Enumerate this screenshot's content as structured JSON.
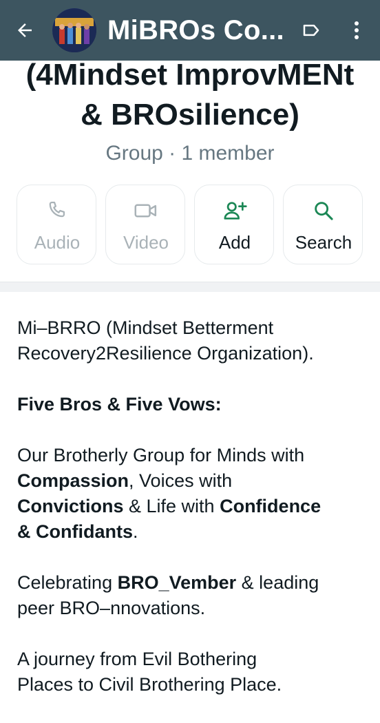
{
  "header": {
    "title": "MiBROs Co...",
    "back_icon": "arrow-left-icon",
    "label_icon": "label-icon",
    "menu_icon": "more-vertical-icon"
  },
  "group": {
    "name_line1": "(4Mindset ImprovMENt",
    "name_line2": "& BROsilience)",
    "subtitle": "Group · 1 member"
  },
  "actions": [
    {
      "label": "Audio",
      "icon": "phone-icon",
      "enabled": false
    },
    {
      "label": "Video",
      "icon": "video-camera-icon",
      "enabled": false
    },
    {
      "label": "Add",
      "icon": "add-person-icon",
      "enabled": true
    },
    {
      "label": "Search",
      "icon": "search-icon",
      "enabled": true
    }
  ],
  "description": {
    "p1_line1": "Mi–BRRO (Mindset Betterment",
    "p1_line2": "Recovery2Resilience Organization).",
    "p2": "Five Bros & Five Vows:",
    "p3_a": "Our Brotherly Group for Minds with",
    "p3_b_bold": "Compassion",
    "p3_c": ", Voices with",
    "p3_d_bold": "Convictions",
    "p3_e": " & Life with ",
    "p3_f_bold": "Confidence",
    "p3_g_bold": "& Confidants",
    "p3_h": ".",
    "p4_a": "Celebrating ",
    "p4_b_bold": "BRO_Vember",
    "p4_c": " & leading",
    "p4_d": "peer BRO–nnovations.",
    "p5_line1": "A journey from Evil Bothering",
    "p5_line2": "Places to Civil Brothering Place."
  },
  "colors": {
    "appbar": "#3d5560",
    "accent": "#1b8755",
    "disabled": "#a9b2b7",
    "text": "#111b21",
    "muted": "#667781"
  }
}
